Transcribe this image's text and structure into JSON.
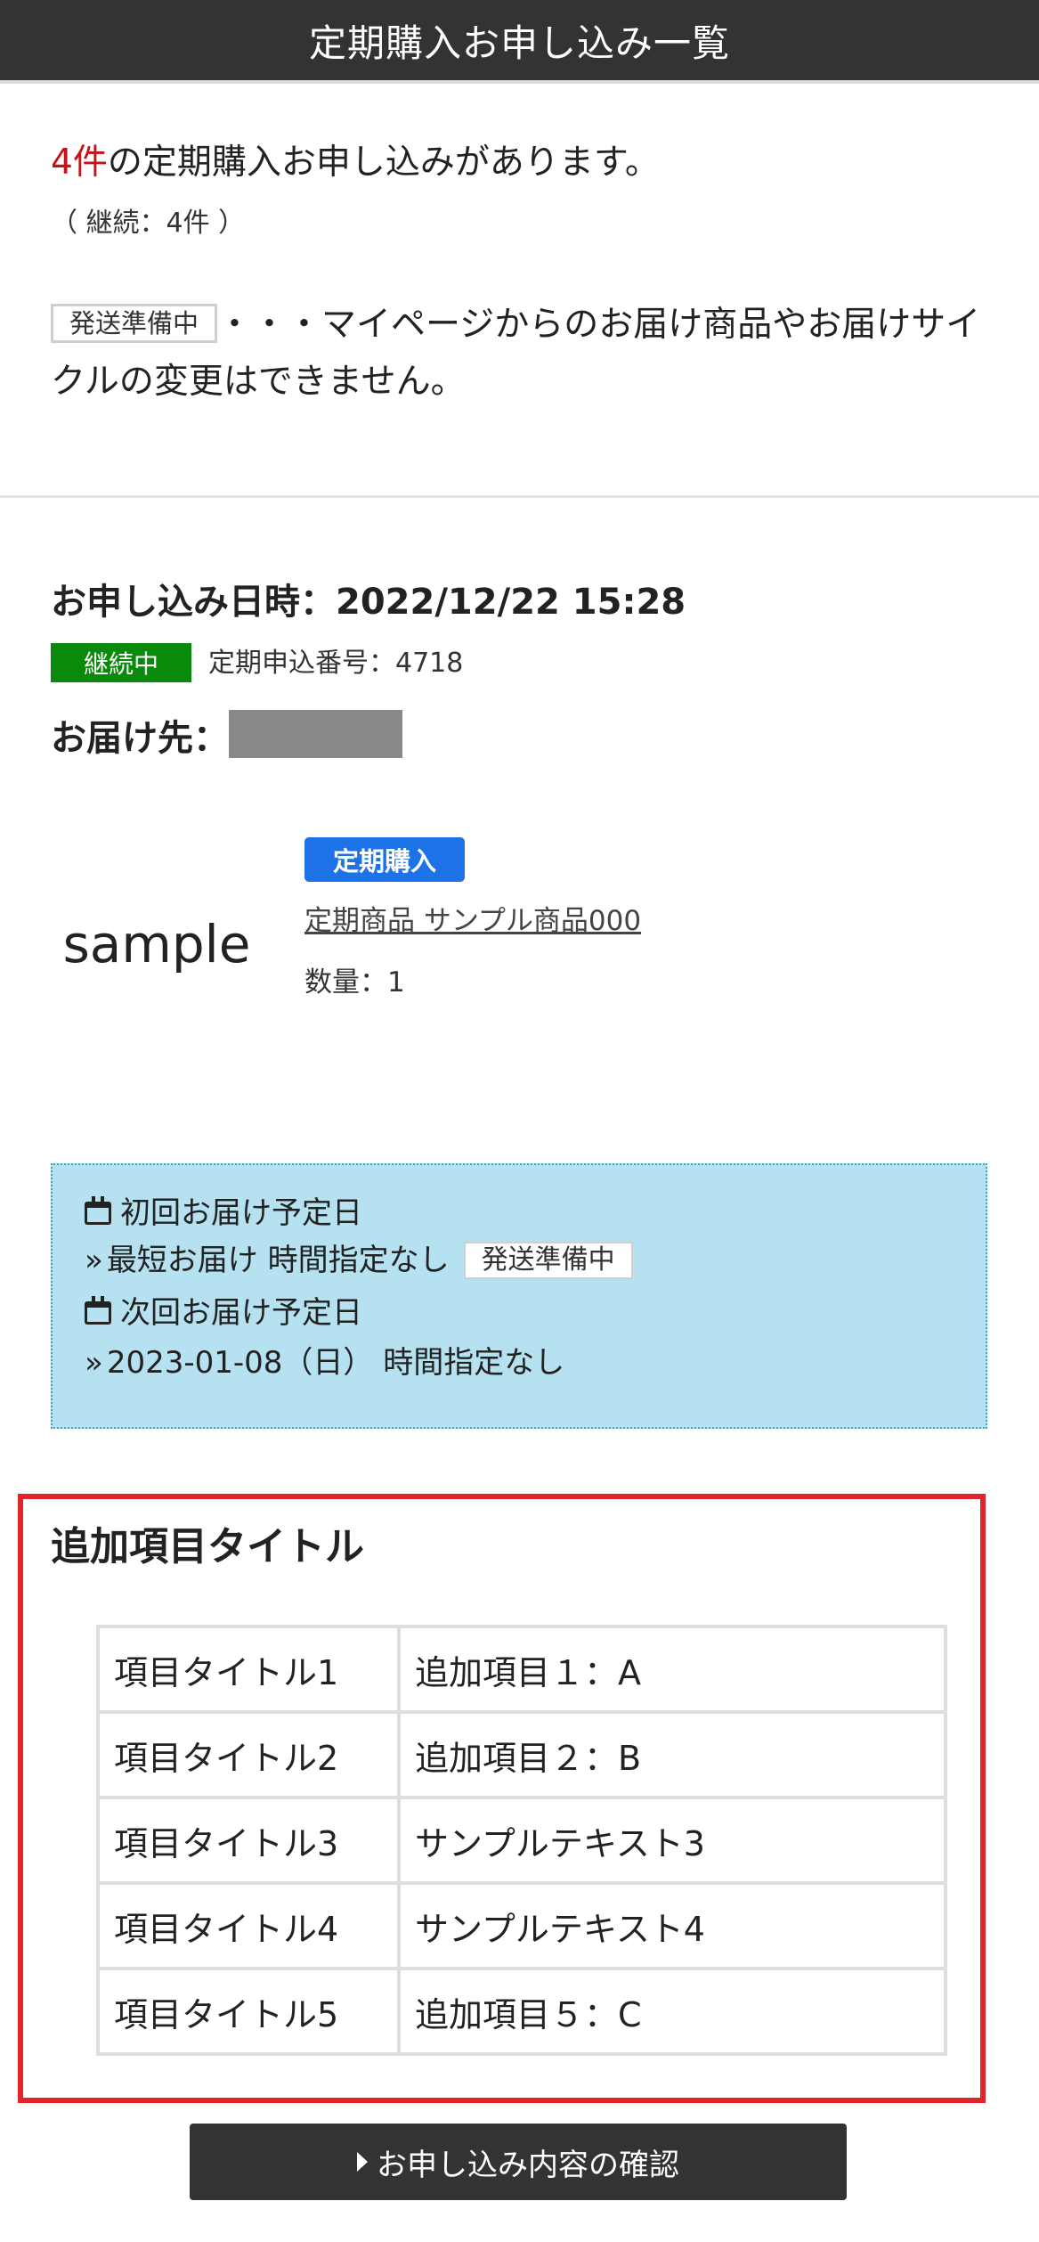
{
  "header": {
    "title": "定期購入お申し込み一覧"
  },
  "summary": {
    "count": "4件",
    "line_rest": "の定期購入お申し込みがあります。",
    "continuing": "（ 継続：4件 ）",
    "legend_chip": "発送準備中",
    "legend_text": "・・・マイページからのお届け商品やお届けサイクルの変更はできません。"
  },
  "order": {
    "date_label": "お申し込み日時：2022/12/22 15:28",
    "status": "継続中",
    "number": "定期申込番号：4718",
    "destination_label": "お届け先：",
    "colors": {
      "status": "#0a8a0a",
      "tag": "#1d72e8"
    }
  },
  "product": {
    "image_text": "sample",
    "tag": "定期購入",
    "name": "定期商品 サンプル商品000",
    "quantity": "数量：1"
  },
  "delivery": {
    "first_label": "初回お届け予定日",
    "first_value": "最短お届け 時間指定なし",
    "first_chip": "発送準備中",
    "next_label": "次回お届け予定日",
    "next_value": "2023-01-08（日） 時間指定なし",
    "icons": {
      "calendar": "calendar-icon",
      "chevron": "double-chevron-right-icon"
    },
    "bg_color": "#b5e1f0"
  },
  "extra": {
    "title": "追加項目タイトル",
    "rows": [
      {
        "key": "項目タイトル1",
        "value": "追加項目１：A"
      },
      {
        "key": "項目タイトル2",
        "value": "追加項目２：B"
      },
      {
        "key": "項目タイトル3",
        "value": "サンプルテキスト3"
      },
      {
        "key": "項目タイトル4",
        "value": "サンプルテキスト4"
      },
      {
        "key": "項目タイトル5",
        "value": "追加項目５：C"
      }
    ],
    "highlight_color": "#e0242b"
  },
  "actions": {
    "confirm": "お申し込み内容の確認"
  }
}
